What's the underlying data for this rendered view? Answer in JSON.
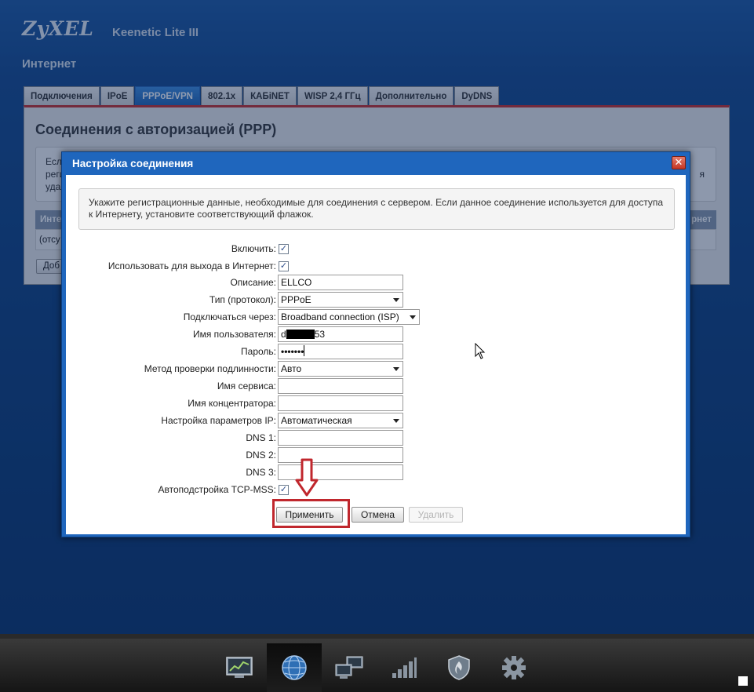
{
  "header": {
    "logo": "ZyXEL",
    "model": "Keenetic Lite III",
    "section_title": "Интернет"
  },
  "tabs": [
    {
      "label": "Подключения",
      "active": false
    },
    {
      "label": "IPoE",
      "active": false
    },
    {
      "label": "PPPoE/VPN",
      "active": true
    },
    {
      "label": "802.1x",
      "active": false
    },
    {
      "label": "КАБiNET",
      "active": false
    },
    {
      "label": "WISP 2,4 ГГц",
      "active": false
    },
    {
      "label": "Дополнительно",
      "active": false
    },
    {
      "label": "DyDNS",
      "active": false
    }
  ],
  "panel": {
    "title": "Соединения с авторизацией (PPP)",
    "note_fragments": [
      "Есл",
      "реги",
      "удал"
    ],
    "note_right_fragment": "я",
    "table_header_left": "Инте",
    "table_header_right": "рнет",
    "row_text": "(отсу",
    "add_button": "Доб"
  },
  "dialog": {
    "title": "Настройка соединения",
    "close": "✕",
    "info": "Укажите регистрационные данные, необходимые для соединения с сервером. Если данное соединение используется для доступа к Интернету, установите соответствующий флажок.",
    "fields": {
      "enable": {
        "label": "Включить:",
        "checked": true
      },
      "use_internet": {
        "label": "Использовать для выхода в Интернет:",
        "checked": true
      },
      "description": {
        "label": "Описание:",
        "value": "ELLCO"
      },
      "protocol": {
        "label": "Тип (протокол):",
        "value": "PPPoE"
      },
      "connect_via": {
        "label": "Подключаться через:",
        "value": "Broadband connection (ISP)"
      },
      "username": {
        "label": "Имя пользователя:",
        "value_start": "d",
        "value_end": "53"
      },
      "password": {
        "label": "Пароль:",
        "value": "•••••••"
      },
      "auth_method": {
        "label": "Метод проверки подлинности:",
        "value": "Авто"
      },
      "service_name": {
        "label": "Имя сервиса:",
        "value": ""
      },
      "concentrator": {
        "label": "Имя концентратора:",
        "value": ""
      },
      "ip_settings": {
        "label": "Настройка параметров IP:",
        "value": "Автоматическая"
      },
      "dns1": {
        "label": "DNS 1:",
        "value": ""
      },
      "dns2": {
        "label": "DNS 2:",
        "value": ""
      },
      "dns3": {
        "label": "DNS 3:",
        "value": ""
      },
      "tcp_mss": {
        "label": "Автоподстройка TCP-MSS:",
        "checked": true
      }
    },
    "buttons": {
      "apply": "Применить",
      "cancel": "Отмена",
      "delete": "Удалить"
    }
  },
  "annotation": {
    "color": "#c0272d"
  },
  "taskbar": {
    "items": [
      {
        "icon": "monitor-chart-icon",
        "active": false
      },
      {
        "icon": "globe-icon",
        "active": true
      },
      {
        "icon": "network-computers-icon",
        "active": false
      },
      {
        "icon": "signal-bars-icon",
        "active": false
      },
      {
        "icon": "shield-icon",
        "active": false
      },
      {
        "icon": "gear-icon",
        "active": false
      }
    ]
  }
}
